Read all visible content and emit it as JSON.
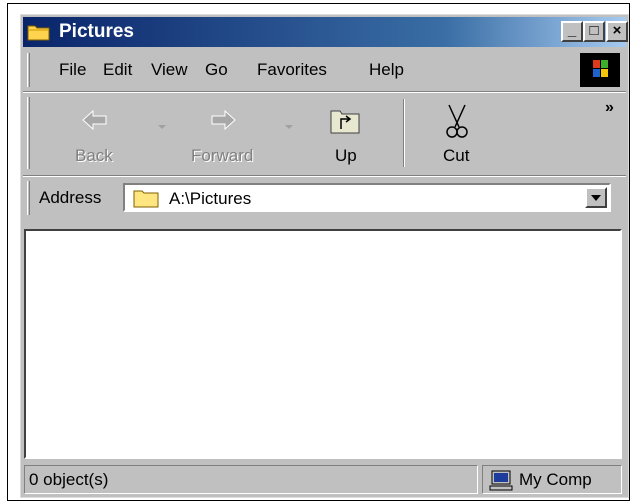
{
  "window": {
    "title": "Pictures"
  },
  "title_buttons": {
    "minimize": "_",
    "maximize": "□",
    "close": "×"
  },
  "menu": [
    {
      "label": "File"
    },
    {
      "label": "Edit"
    },
    {
      "label": "View"
    },
    {
      "label": "Go"
    },
    {
      "label": "Favorites"
    },
    {
      "label": "Help"
    }
  ],
  "toolbar": {
    "back": {
      "label": "Back",
      "icon": "back-arrow-icon",
      "enabled": false
    },
    "forward": {
      "label": "Forward",
      "icon": "forward-arrow-icon",
      "enabled": false
    },
    "up": {
      "label": "Up",
      "icon": "up-folder-icon",
      "enabled": true
    },
    "cut": {
      "label": "Cut",
      "icon": "scissors-icon",
      "enabled": true
    },
    "more": "»"
  },
  "address": {
    "label": "Address",
    "value": "A:\\Pictures",
    "icon": "folder-icon"
  },
  "status": {
    "objects": "0 object(s)",
    "zone": "My Comp"
  },
  "colors": {
    "titlebar_start": "#0a246a",
    "titlebar_end": "#a6caf0",
    "chrome": "#c0c0c0"
  }
}
